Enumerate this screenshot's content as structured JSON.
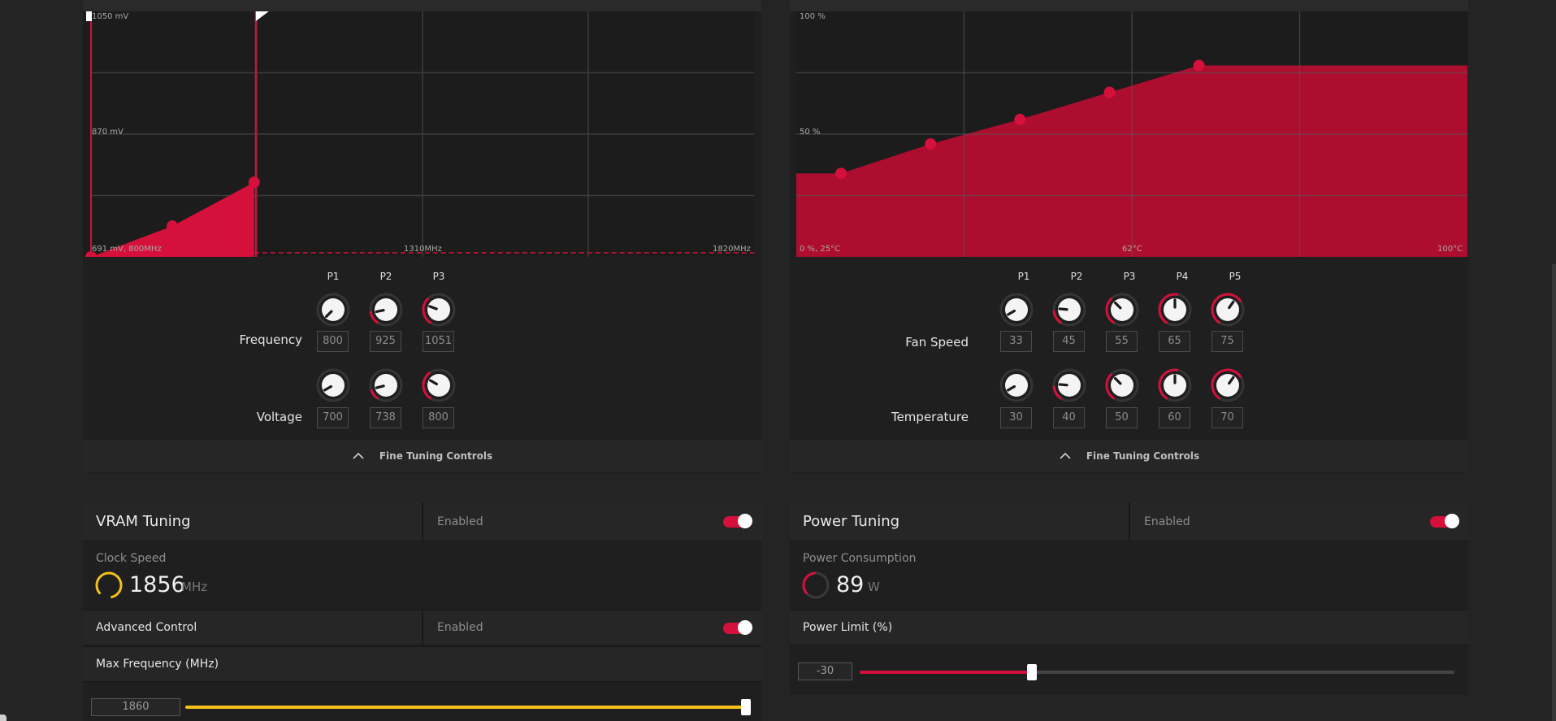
{
  "colors": {
    "accent": "#d5103a",
    "vram_accent": "#f2c11a",
    "bg": "#242424"
  },
  "gpu_chart": {
    "labels": {
      "top_voltage": "1050 mV",
      "mid_voltage": "870 mV",
      "origin": "691 mV, 800MHz",
      "mid_freq": "1310MHz",
      "max_freq": "1820MHz"
    },
    "x_range_mhz": [
      800,
      1820
    ],
    "y_range_mv": [
      691,
      1050
    ],
    "points": [
      {
        "freq": 800,
        "mv": 691
      },
      {
        "freq": 925,
        "mv": 736
      },
      {
        "freq": 1051,
        "mv": 800
      }
    ]
  },
  "gpu_tuning": {
    "columns": [
      "P1",
      "P2",
      "P3"
    ],
    "frequency_label": "Frequency",
    "voltage_label": "Voltage",
    "frequency_values": [
      "800",
      "925",
      "1051"
    ],
    "voltage_values": [
      "700",
      "738",
      "800"
    ],
    "footer_label": "Fine Tuning Controls"
  },
  "fan_chart": {
    "labels": {
      "top_pct": "100 %",
      "mid_pct": "50 %",
      "origin": "0 %, 25°C",
      "mid_temp": "62°C",
      "max_temp": "100°C"
    },
    "x_range_c": [
      25,
      100
    ],
    "y_range_pct": [
      0,
      100
    ],
    "points": [
      {
        "temp": 30,
        "pct": 34
      },
      {
        "temp": 40,
        "pct": 46
      },
      {
        "temp": 50,
        "pct": 56
      },
      {
        "temp": 60,
        "pct": 67
      },
      {
        "temp": 70,
        "pct": 78
      }
    ]
  },
  "fan_tuning": {
    "columns": [
      "P1",
      "P2",
      "P3",
      "P4",
      "P5"
    ],
    "fan_speed_label": "Fan Speed",
    "temperature_label": "Temperature",
    "fan_speed_values": [
      "33",
      "45",
      "55",
      "65",
      "75"
    ],
    "temperature_values": [
      "30",
      "40",
      "50",
      "60",
      "70"
    ],
    "footer_label": "Fine Tuning Controls"
  },
  "vram": {
    "title": "VRAM Tuning",
    "status": "Enabled",
    "clock_label": "Clock Speed",
    "clock_value": "1856",
    "clock_unit": "MHz",
    "advanced_label": "Advanced Control",
    "advanced_status": "Enabled",
    "max_freq_label": "Max Frequency (MHz)",
    "max_freq_value": "1860",
    "max_freq_fraction": 1.0
  },
  "power": {
    "title": "Power Tuning",
    "status": "Enabled",
    "consumption_label": "Power Consumption",
    "consumption_value": "89",
    "consumption_unit": "W",
    "limit_label": "Power Limit (%)",
    "limit_value": "-30",
    "limit_fraction": 0.29
  }
}
